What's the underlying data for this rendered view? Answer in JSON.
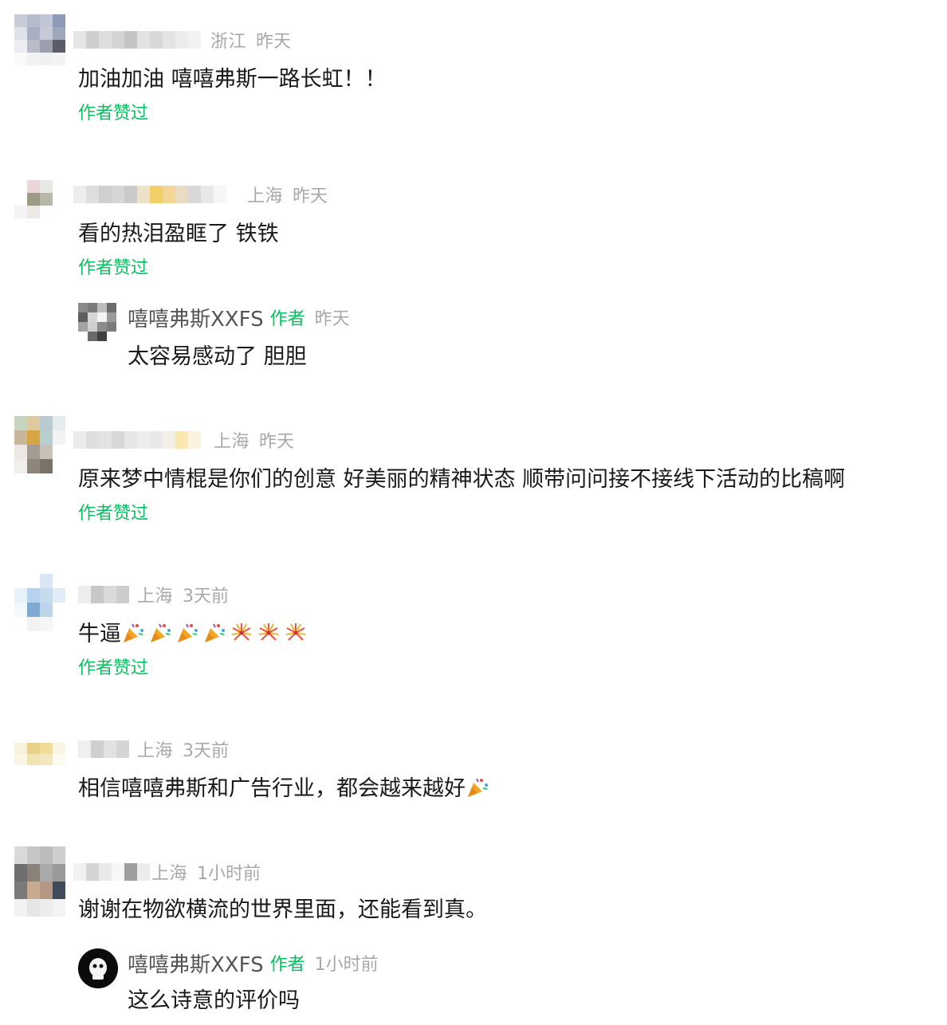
{
  "comments": [
    {
      "region": "浙江",
      "time": "昨天",
      "text": "加油加油 嘻嘻弗斯一路长虹！！",
      "liked_label": "作者赞过"
    },
    {
      "region": "上海",
      "time": "昨天",
      "text": "看的热泪盈眶了 铁铁",
      "liked_label": "作者赞过",
      "reply": {
        "name": "嘻嘻弗斯XXFS",
        "badge": "作者",
        "time": "昨天",
        "text": "太容易感动了 胆胆"
      }
    },
    {
      "region": "上海",
      "time": "昨天",
      "text": "原来梦中情棍是你们的创意 好美丽的精神状态 顺带问问接不接线下活动的比稿啊",
      "liked_label": "作者赞过"
    },
    {
      "region": "上海",
      "time": "3天前",
      "text": "牛逼",
      "emojis": [
        "party-popper",
        "party-popper",
        "party-popper",
        "party-popper",
        "fireworks",
        "fireworks",
        "fireworks"
      ],
      "liked_label": "作者赞过"
    },
    {
      "region": "上海",
      "time": "3天前",
      "text": "相信嘻嘻弗斯和广告行业，都会越来越好",
      "emojis": [
        "party-popper"
      ]
    },
    {
      "region": "上海",
      "time": "1小时前",
      "text": "谢谢在物欲横流的世界里面，还能看到真。",
      "reply": {
        "name": "嘻嘻弗斯XXFS",
        "badge": "作者",
        "time": "1小时前",
        "text": "这么诗意的评价吗"
      }
    }
  ],
  "colors": {
    "accent_green": "#07c160",
    "meta_gray": "#a8a8a8"
  }
}
